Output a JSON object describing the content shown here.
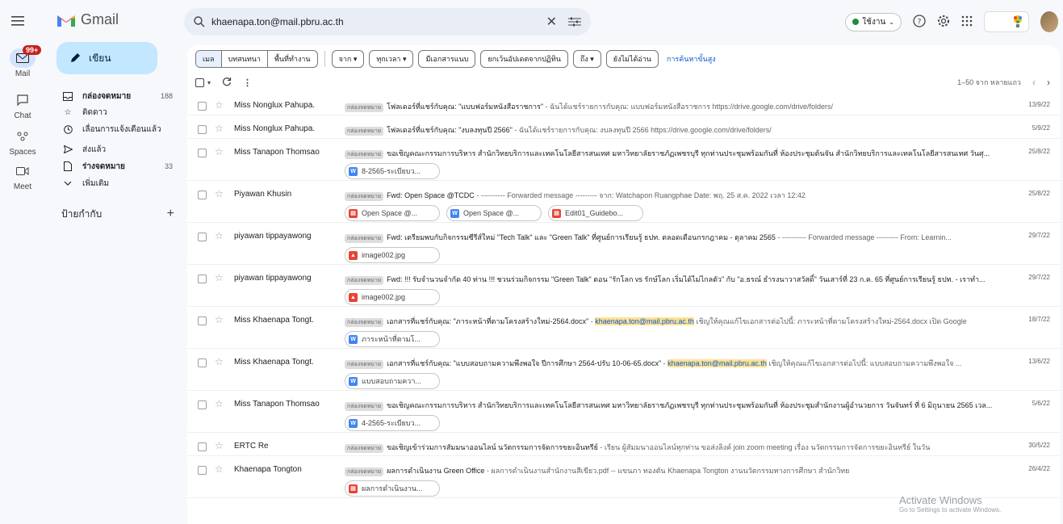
{
  "rail": {
    "mail": {
      "label": "Mail",
      "badge": "99+"
    },
    "chat": {
      "label": "Chat"
    },
    "spaces": {
      "label": "Spaces"
    },
    "meet": {
      "label": "Meet"
    }
  },
  "app": {
    "title": "Gmail"
  },
  "compose": {
    "label": "เขียน"
  },
  "nav": [
    {
      "label": "กล่องจดหมาย",
      "count": "188"
    },
    {
      "label": "ติดดาว",
      "count": ""
    },
    {
      "label": "เลื่อนการแจ้งเตือนแล้ว",
      "count": ""
    },
    {
      "label": "ส่งแล้ว",
      "count": ""
    },
    {
      "label": "ร่างจดหมาย",
      "count": "33"
    },
    {
      "label": "เพิ่มเติม",
      "count": ""
    }
  ],
  "labels": {
    "title": "ป้ายกำกับ",
    "add": "+"
  },
  "search": {
    "value": "khaenapa.ton@mail.pbru.ac.th"
  },
  "topbar": {
    "status": "ใช้งาน"
  },
  "filters": {
    "seg": [
      "เมล",
      "บทสนทนา",
      "พื้นที่ทำงาน"
    ],
    "chips": [
      "จาก ▾",
      "ทุกเวลา ▾",
      "มีเอกสารแนบ",
      "ยกเว้นอัปเดตจากปฏิทิน",
      "ถึง ▾",
      "ยังไม่ได้อ่าน"
    ],
    "advanced": "การค้นหาขั้นสูง"
  },
  "toolbar": {
    "pager": "1–50 จาก หลายแถว"
  },
  "tag_label": "กล่องจดหมาย",
  "emails": [
    {
      "sender": "Miss Nonglux Pahupa.",
      "subject": "โฟลเดอร์ที่แชร์กับคุณ: \"แบบฟอร์มหนังสือราชการ\"",
      "snippet": " - ฉันได้แชร์รายการกับคุณ: แบบฟอร์มหนังสือราชการ https://drive.google.com/drive/folders/",
      "date": "13/9/22",
      "atts": []
    },
    {
      "sender": "Miss Nonglux Pahupa.",
      "subject": "โฟลเดอร์ที่แชร์กับคุณ: \"งบลงทุนปี 2566\"",
      "snippet": " - ฉันได้แชร์รายการกับคุณ: งบลงทุนปี 2566 https://drive.google.com/drive/folders/",
      "date": "5/9/22",
      "atts": []
    },
    {
      "sender": "Miss Tanapon Thomsao",
      "subject": "ขอเชิญคณะกรรมการบริหาร สำนักวิทยบริการและเทคโนโลยีสารสนเทศ มหาวิทยาลัยราชภัฏเพชรบุรี ทุกท่านประชุมพร้อมกันที่ ห้องประชุมต้นจัน สำนักวิทยบริการและเทคโนโลยีสารสนเทศ วันศุ...",
      "snippet": "",
      "date": "25/8/22",
      "atts": [
        {
          "type": "w",
          "name": "8-2565-ระเบียบว..."
        }
      ]
    },
    {
      "sender": "Piyawan Khusin",
      "subject": "Fwd: Open Space @TCDC",
      "snippet": " - ---------- Forwarded message --------- จาก: Watchapon Ruangphae Date: พฤ. 25 ส.ค. 2022 เวลา 12:42",
      "date": "25/8/22",
      "atts": [
        {
          "type": "p",
          "name": "Open Space @..."
        },
        {
          "type": "w",
          "name": "Open Space @..."
        },
        {
          "type": "p",
          "name": "Edit01_Guidebo..."
        }
      ]
    },
    {
      "sender": "piyawan tippayawong",
      "subject": "Fwd: เตรียมพบกับกิจกรรมซีรีส์ใหม่ \"Tech Talk\" และ \"Green Talk\" ที่ศูนย์การเรียนรู้ ธปท. ตลอดเดือนกรกฎาคม - ตุลาคม 2565",
      "snippet": " - ---------- Forwarded message --------- From: Learnin...",
      "date": "29/7/22",
      "atts": [
        {
          "type": "img",
          "name": "image002.jpg"
        }
      ]
    },
    {
      "sender": "piyawan tippayawong",
      "subject": "Fwd: !!! รับจำนวนจำกัด 40 ท่าน !!! ชวนร่วมกิจกรรม \"Green Talk\" ตอน \"รักโลก vs รักษ์โลก เริ่มได้ไม่ไกลตัว\" กับ \"อ.ธรณ์ ธำรงนาวาสวัสดิ์\" วันเสาร์ที่ 23 ก.ค. 65 ที่ศูนย์การเรียนรู้ ธปท. - เราทำ...",
      "snippet": "",
      "date": "29/7/22",
      "atts": [
        {
          "type": "img",
          "name": "image002.jpg"
        }
      ]
    },
    {
      "sender": "Miss Khaenapa Tongt.",
      "subject": "เอกสารที่แชร์กับคุณ: \"ภาระหน้าที่ตามโครงสร้างใหม่-2564.docx\"",
      "snippet_pre": " - ",
      "email": "khaenapa.ton@mail.pbru.ac.th",
      "snippet": " เชิญให้คุณแก้ไขเอกสารต่อไปนี้: ภาระหน้าที่ตามโครงสร้างใหม่-2564.docx เปิด Google",
      "date": "18/7/22",
      "atts": [
        {
          "type": "w",
          "name": "ภาระหน้าที่ตามโ..."
        }
      ]
    },
    {
      "sender": "Miss Khaenapa Tongt.",
      "subject": "เอกสารที่แชร์กับคุณ: \"แบบสอบถามความพึงพอใจ ปีการศึกษา 2564-ปรับ 10-06-65.docx\"",
      "snippet_pre": " - ",
      "email": "khaenapa.ton@mail.pbru.ac.th",
      "snippet": " เชิญให้คุณแก้ไขเอกสารต่อไปนี้: แบบสอบถามความพึงพอใจ ...",
      "date": "13/6/22",
      "atts": [
        {
          "type": "w",
          "name": "แบบสอบถามควา..."
        }
      ]
    },
    {
      "sender": "Miss Tanapon Thomsao",
      "subject": "ขอเชิญคณะกรรมการบริหาร สำนักวิทยบริการและเทคโนโลยีสารสนเทศ มหาวิทยาลัยราชภัฏเพชรบุรี ทุกท่านประชุมพร้อมกันที่ ห้องประชุมสำนักงานผู้อำนวยการ วันจันทร์ ที่ 6 มิถุนายน 2565 เวล...",
      "snippet": "",
      "date": "5/6/22",
      "atts": [
        {
          "type": "w",
          "name": "4-2565-ระเบียบว..."
        }
      ]
    },
    {
      "sender": "ERTC Re",
      "subject": "ขอเชิญเข้าร่วมการสัมมนาออนไลน์ นวัตกรรมการจัดการขยะอินทรีย์",
      "snippet": " - เรียน ผู้สัมมนาออนไลน์ทุกท่าน ขอส่งลิงค์ join zoom meeting เรื่อง นวัตกรรมการจัดการขยะอินทรีย์ ในวัน",
      "date": "30/5/22",
      "atts": []
    },
    {
      "sender": "Khaenapa Tongton",
      "subject": "ผลการดำเนินงาน Green Office",
      "snippet": " - ผลการดำเนินงานสำนักงานสีเขียว.pdf -- แขนภา ทองตัน Khaenapa Tongton งานนวัตกรรมทางการศึกษา สำนักวิทย",
      "date": "26/4/22",
      "atts": [
        {
          "type": "p",
          "name": "ผลการดำเนินงาน..."
        }
      ]
    }
  ],
  "watermark": {
    "title": "Activate Windows",
    "sub": "Go to Settings to activate Windows."
  }
}
